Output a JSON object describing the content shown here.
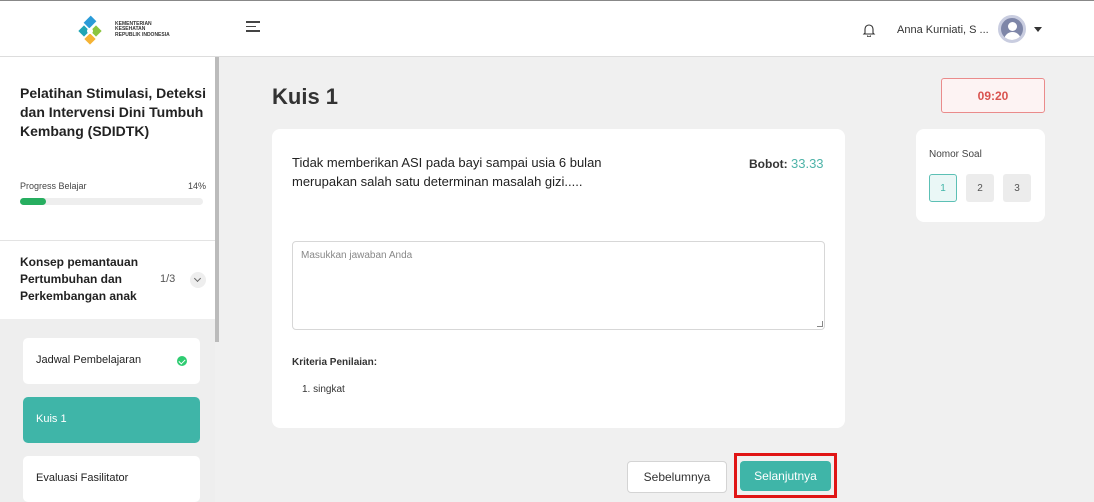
{
  "header": {
    "logo_text": "KEMENTERIAN KESEHATAN REPUBLIK INDONESIA",
    "user_name": "Anna Kurniati, S ..."
  },
  "sidebar": {
    "course_title": "Pelatihan Stimulasi, Deteksi dan Intervensi Dini Tumbuh Kembang (SDIDTK)",
    "progress_label": "Progress Belajar",
    "progress_percent_text": "14%",
    "progress_value": 0.14,
    "module_title": "Konsep pemantauan Pertumbuhan dan Perkembangan anak",
    "module_count": "1/3",
    "lessons": [
      {
        "label": "Jadwal Pembelajaran",
        "completed": true,
        "active": false
      },
      {
        "label": "Kuis 1",
        "completed": false,
        "active": true
      },
      {
        "label": "Evaluasi Fasilitator",
        "completed": false,
        "active": false
      }
    ]
  },
  "main": {
    "title": "Kuis 1",
    "timer": "09:20",
    "question": "Tidak memberikan ASI pada bayi sampai usia 6 bulan merupakan salah satu determinan masalah gizi.....",
    "weight_label": "Bobot:",
    "weight_value": "33.33",
    "answer_placeholder": "Masukkan jawaban Anda",
    "answer_value": "",
    "criteria_title": "Kriteria Penilaian:",
    "criteria_items": [
      "1. singkat"
    ],
    "prev_button": "Sebelumnya",
    "next_button": "Selanjutnya"
  },
  "question_nav": {
    "title": "Nomor Soal",
    "numbers": [
      "1",
      "2",
      "3"
    ],
    "current": "1"
  },
  "colors": {
    "accent": "#3fb5a8",
    "timer_red": "#d9534f",
    "highlight": "#e01515",
    "progress": "#27ae60"
  }
}
